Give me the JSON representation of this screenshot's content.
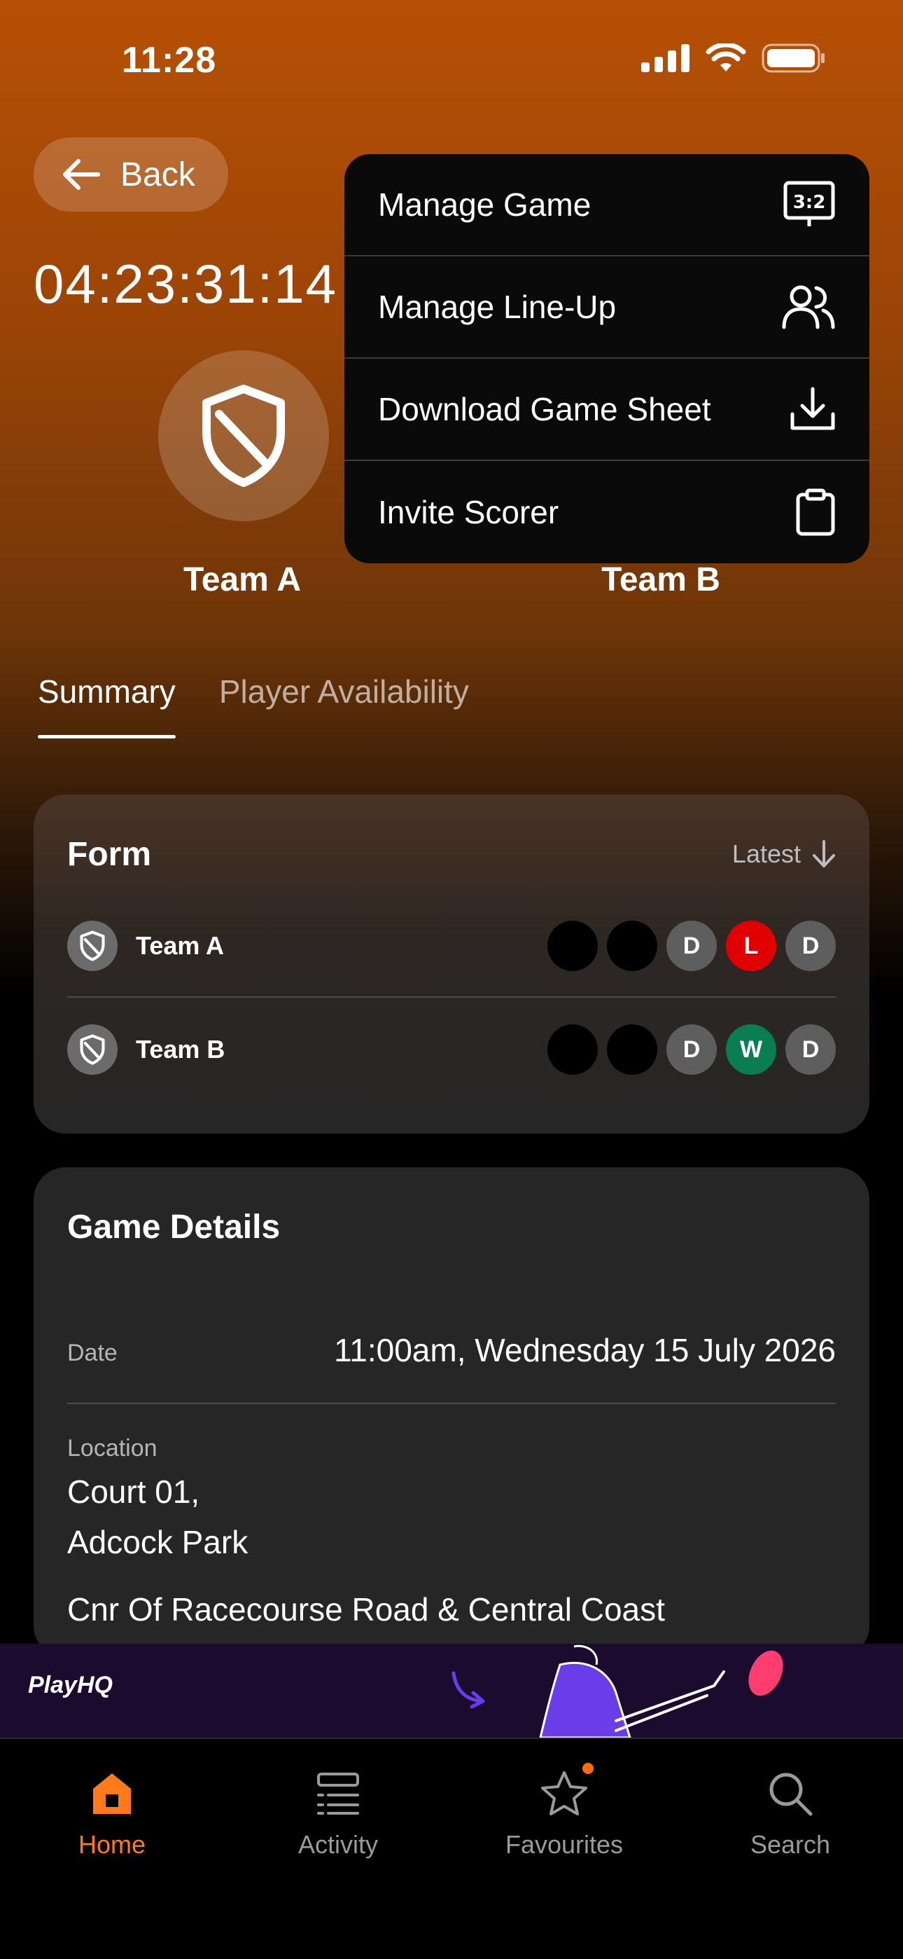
{
  "status_bar": {
    "time": "11:28"
  },
  "header": {
    "back_label": "Back",
    "countdown": "04:23:31:14"
  },
  "teams": {
    "home": "Team A",
    "away": "Team B"
  },
  "menu": {
    "items": [
      {
        "label": "Manage Game",
        "icon": "scoreboard-icon"
      },
      {
        "label": "Manage Line-Up",
        "icon": "users-icon"
      },
      {
        "label": "Download Game Sheet",
        "icon": "download-icon"
      },
      {
        "label": "Invite Scorer",
        "icon": "clipboard-icon"
      }
    ]
  },
  "tabs": [
    {
      "label": "Summary",
      "active": true
    },
    {
      "label": "Player Availability",
      "active": false
    }
  ],
  "form": {
    "title": "Form",
    "sort_label": "Latest",
    "rows": [
      {
        "team": "Team A",
        "results": [
          "",
          "",
          "D",
          "L",
          "D"
        ]
      },
      {
        "team": "Team B",
        "results": [
          "",
          "",
          "D",
          "W",
          "D"
        ]
      }
    ],
    "colors": {
      "draw": "#5e5e5e",
      "loss": "#e00000",
      "win": "#0a7d55"
    }
  },
  "game_details": {
    "title": "Game Details",
    "date_label": "Date",
    "date_value": "11:00am, Wednesday 15 July 2026",
    "location_label": "Location",
    "location_line1": "Court 01,",
    "location_line2": "Adcock Park",
    "address": "Cnr Of Racecourse Road & Central Coast"
  },
  "banner": {
    "logo_text": "PlayHQ"
  },
  "bottom_nav": {
    "items": [
      {
        "label": "Home",
        "icon": "home-icon",
        "active": true
      },
      {
        "label": "Activity",
        "icon": "list-icon",
        "active": false
      },
      {
        "label": "Favourites",
        "icon": "star-icon",
        "active": false
      },
      {
        "label": "Search",
        "icon": "search-icon",
        "active": false
      }
    ],
    "accent": "#ff7a1a"
  }
}
